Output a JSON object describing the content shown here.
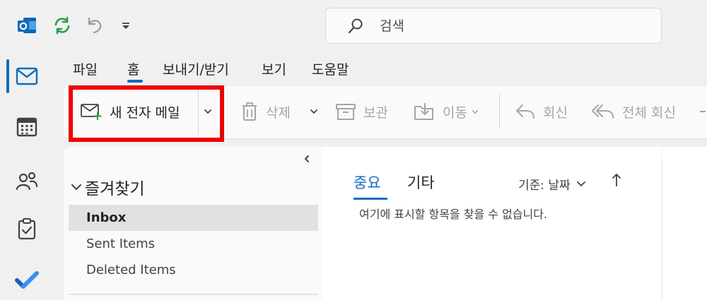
{
  "search": {
    "placeholder": "검색"
  },
  "ribbon_tabs": [
    {
      "label": "파일"
    },
    {
      "label": "홈"
    },
    {
      "label": "보내기/받기"
    },
    {
      "label": "보기"
    },
    {
      "label": "도움말"
    }
  ],
  "ribbon": {
    "new_mail": "새 전자 메일",
    "delete": "삭제",
    "archive": "보관",
    "move": "이동",
    "reply": "회신",
    "reply_all": "전체 회신"
  },
  "folder_pane": {
    "favorites_header": "즐겨찾기",
    "folders": [
      {
        "label": "Inbox"
      },
      {
        "label": "Sent Items"
      },
      {
        "label": "Deleted Items"
      }
    ]
  },
  "message_list": {
    "tabs": [
      {
        "label": "중요"
      },
      {
        "label": "기타"
      }
    ],
    "sort_label": "기준: 날짜",
    "empty_text": "여기에 표시할 항목을 찾을 수 없습니다."
  },
  "colors": {
    "accent": "#0f6cbd",
    "highlight_box": "#ee0000",
    "todo_blue": "#2564cf"
  }
}
